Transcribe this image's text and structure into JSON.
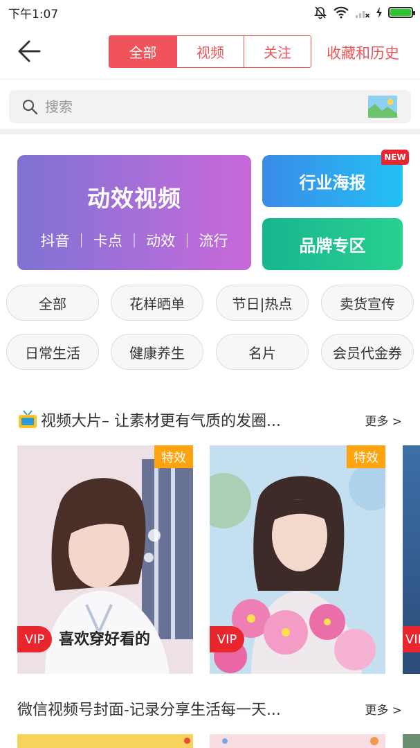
{
  "status_bar": {
    "time": "下午1:07",
    "battery_level": 1.0,
    "battery_color": "#2ec52e"
  },
  "header": {
    "back_icon": "arrow-left-icon",
    "tabs": [
      {
        "label": "全部",
        "active": true
      },
      {
        "label": "视频",
        "active": false
      },
      {
        "label": "关注",
        "active": false
      }
    ],
    "history_label": "收藏和历史",
    "accent_color": "#f0535a"
  },
  "search": {
    "placeholder": "搜索",
    "icon": "search-icon",
    "image_search_icon": "image-search-icon"
  },
  "promo": {
    "main": {
      "title": "动效视频",
      "subtitle": "抖音 ｜ 卡点 ｜ 动效 ｜ 流行"
    },
    "poster": {
      "title": "行业海报",
      "badge": "NEW"
    },
    "brand": {
      "title": "品牌专区"
    }
  },
  "categories": [
    "全部",
    "花样晒单",
    "节日|热点",
    "卖货宣传",
    "日常生活",
    "健康养生",
    "名片",
    "会员代金券"
  ],
  "sections": [
    {
      "icon": "tv-icon",
      "title": "视频大片– 让素材更有气质的发圈...",
      "more": "更多 >",
      "cards": [
        {
          "tag": "特效",
          "vip": "VIP",
          "caption": "喜欢穿好看的"
        },
        {
          "tag": "特效",
          "vip": "VIP",
          "caption": ""
        },
        {
          "tag": "",
          "vip": "VIP",
          "caption": ""
        }
      ]
    },
    {
      "title": "微信视频号封面-记录分享生活每一天...",
      "more": "更多 >"
    }
  ]
}
